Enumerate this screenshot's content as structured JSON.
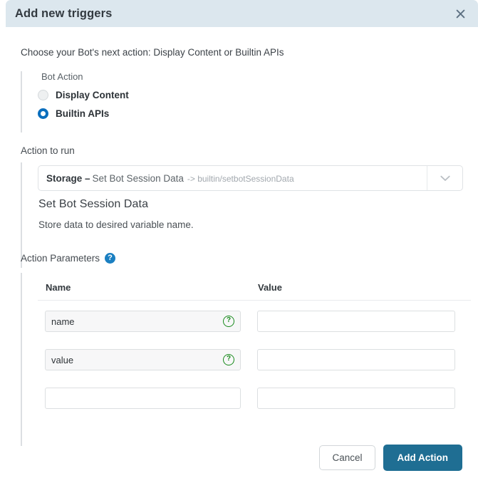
{
  "header": {
    "title": "Add new triggers",
    "close_icon": "close-icon"
  },
  "body": {
    "intro_text": "Choose your Bot's next action: Display Content or Builtin APIs",
    "bot_action": {
      "label": "Bot Action",
      "options": [
        {
          "label": "Display Content",
          "selected": false
        },
        {
          "label": "Builtin APIs",
          "selected": true
        }
      ]
    },
    "action_to_run": {
      "label": "Action to run",
      "select": {
        "prefix": "Storage –",
        "main": "Set Bot Session Data",
        "path": "-> builtin/setbotSessionData",
        "chevron_icon": "chevron-down-icon"
      },
      "action_title": "Set Bot Session Data",
      "action_description": "Store data to desired variable name."
    },
    "action_parameters": {
      "label": "Action Parameters",
      "help_icon": "help-circle-icon",
      "columns": {
        "name": "Name",
        "value": "Value"
      },
      "rows": [
        {
          "name": "name",
          "value": "",
          "has_help": true
        },
        {
          "name": "value",
          "value": "",
          "has_help": true
        },
        {
          "name": "",
          "value": "",
          "has_help": false
        }
      ]
    }
  },
  "footer": {
    "cancel_label": "Cancel",
    "submit_label": "Add Action"
  },
  "colors": {
    "header_bg": "#dce7ee",
    "primary_button": "#1f6e93",
    "radio_selected": "#0a6ebd",
    "help_blue": "#1a7fc1",
    "help_green": "#188a1c"
  }
}
